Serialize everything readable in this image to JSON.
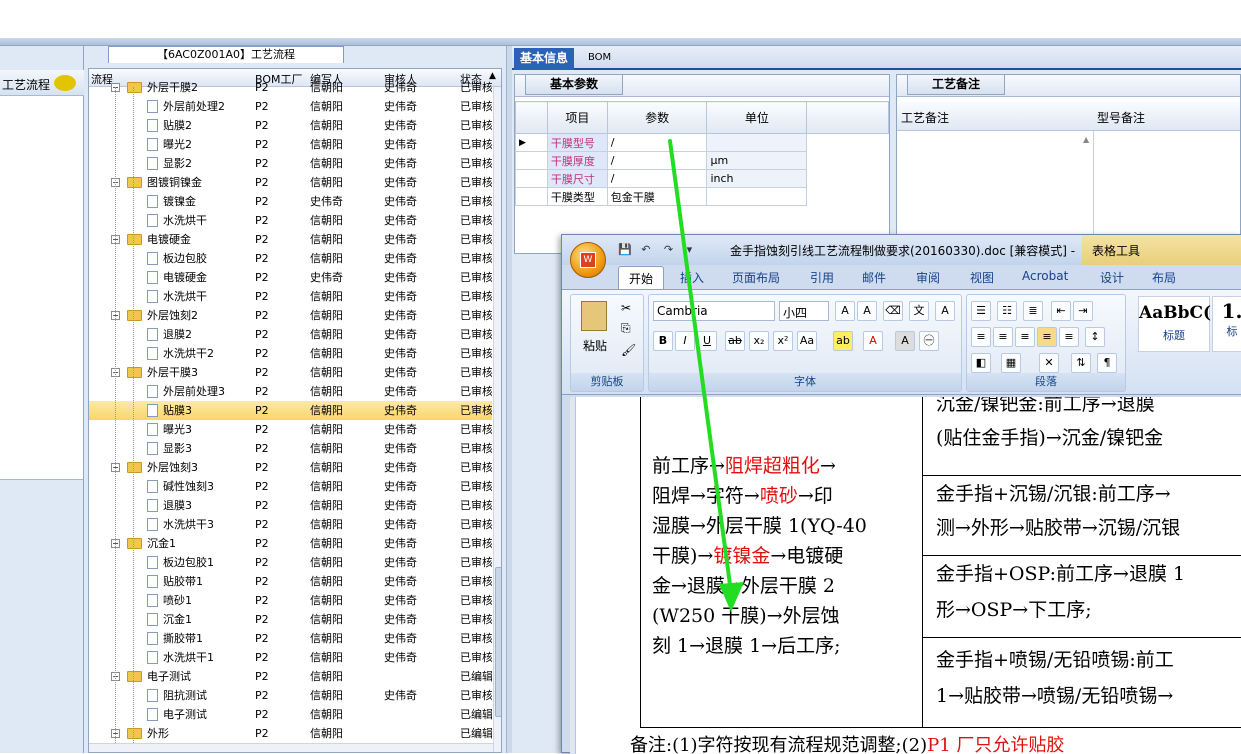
{
  "left_panel": {
    "label": "工艺流程"
  },
  "tree": {
    "title": "【6AC0Z001A0】工艺流程",
    "headers": [
      "流程",
      "BOM工厂",
      "编写人",
      "审核人",
      "状态"
    ],
    "rows": [
      {
        "name": "外层干膜2",
        "level": 1,
        "folder": true,
        "bom": "P2",
        "writer": "信朝阳",
        "reviewer": "史伟奇",
        "status": "已审核"
      },
      {
        "name": "外层前处理2",
        "level": 2,
        "bom": "P2",
        "writer": "信朝阳",
        "reviewer": "史伟奇",
        "status": "已审核"
      },
      {
        "name": "贴膜2",
        "level": 2,
        "bom": "P2",
        "writer": "信朝阳",
        "reviewer": "史伟奇",
        "status": "已审核"
      },
      {
        "name": "曝光2",
        "level": 2,
        "bom": "P2",
        "writer": "信朝阳",
        "reviewer": "史伟奇",
        "status": "已审核"
      },
      {
        "name": "显影2",
        "level": 2,
        "bom": "P2",
        "writer": "信朝阳",
        "reviewer": "史伟奇",
        "status": "已审核"
      },
      {
        "name": "图镀铜镍金",
        "level": 1,
        "folder": true,
        "bom": "P2",
        "writer": "信朝阳",
        "reviewer": "史伟奇",
        "status": "已审核"
      },
      {
        "name": "镀镍金",
        "level": 2,
        "bom": "P2",
        "writer": "史伟奇",
        "reviewer": "史伟奇",
        "status": "已审核"
      },
      {
        "name": "水洗烘干",
        "level": 2,
        "bom": "P2",
        "writer": "信朝阳",
        "reviewer": "史伟奇",
        "status": "已审核"
      },
      {
        "name": "电镀硬金",
        "level": 1,
        "folder": true,
        "bom": "P2",
        "writer": "信朝阳",
        "reviewer": "史伟奇",
        "status": "已审核"
      },
      {
        "name": "板边包胶",
        "level": 2,
        "bom": "P2",
        "writer": "信朝阳",
        "reviewer": "史伟奇",
        "status": "已审核"
      },
      {
        "name": "电镀硬金",
        "level": 2,
        "bom": "P2",
        "writer": "史伟奇",
        "reviewer": "史伟奇",
        "status": "已审核"
      },
      {
        "name": "水洗烘干",
        "level": 2,
        "bom": "P2",
        "writer": "信朝阳",
        "reviewer": "史伟奇",
        "status": "已审核"
      },
      {
        "name": "外层蚀刻2",
        "level": 1,
        "folder": true,
        "bom": "P2",
        "writer": "信朝阳",
        "reviewer": "史伟奇",
        "status": "已审核"
      },
      {
        "name": "退膜2",
        "level": 2,
        "bom": "P2",
        "writer": "信朝阳",
        "reviewer": "史伟奇",
        "status": "已审核"
      },
      {
        "name": "水洗烘干2",
        "level": 2,
        "bom": "P2",
        "writer": "信朝阳",
        "reviewer": "史伟奇",
        "status": "已审核"
      },
      {
        "name": "外层干膜3",
        "level": 1,
        "folder": true,
        "bom": "P2",
        "writer": "信朝阳",
        "reviewer": "史伟奇",
        "status": "已审核"
      },
      {
        "name": "外层前处理3",
        "level": 2,
        "bom": "P2",
        "writer": "信朝阳",
        "reviewer": "史伟奇",
        "status": "已审核"
      },
      {
        "name": "贴膜3",
        "level": 2,
        "bom": "P2",
        "writer": "信朝阳",
        "reviewer": "史伟奇",
        "status": "已审核",
        "selected": true
      },
      {
        "name": "曝光3",
        "level": 2,
        "bom": "P2",
        "writer": "信朝阳",
        "reviewer": "史伟奇",
        "status": "已审核"
      },
      {
        "name": "显影3",
        "level": 2,
        "bom": "P2",
        "writer": "信朝阳",
        "reviewer": "史伟奇",
        "status": "已审核"
      },
      {
        "name": "外层蚀刻3",
        "level": 1,
        "folder": true,
        "bom": "P2",
        "writer": "信朝阳",
        "reviewer": "史伟奇",
        "status": "已审核"
      },
      {
        "name": "碱性蚀刻3",
        "level": 2,
        "bom": "P2",
        "writer": "信朝阳",
        "reviewer": "史伟奇",
        "status": "已审核"
      },
      {
        "name": "退膜3",
        "level": 2,
        "bom": "P2",
        "writer": "信朝阳",
        "reviewer": "史伟奇",
        "status": "已审核"
      },
      {
        "name": "水洗烘干3",
        "level": 2,
        "bom": "P2",
        "writer": "信朝阳",
        "reviewer": "史伟奇",
        "status": "已审核"
      },
      {
        "name": "沉金1",
        "level": 1,
        "folder": true,
        "bom": "P2",
        "writer": "信朝阳",
        "reviewer": "史伟奇",
        "status": "已审核"
      },
      {
        "name": "板边包胶1",
        "level": 2,
        "bom": "P2",
        "writer": "信朝阳",
        "reviewer": "史伟奇",
        "status": "已审核"
      },
      {
        "name": "贴胶带1",
        "level": 2,
        "bom": "P2",
        "writer": "信朝阳",
        "reviewer": "史伟奇",
        "status": "已审核"
      },
      {
        "name": "喷砂1",
        "level": 2,
        "bom": "P2",
        "writer": "信朝阳",
        "reviewer": "史伟奇",
        "status": "已审核"
      },
      {
        "name": "沉金1",
        "level": 2,
        "bom": "P2",
        "writer": "信朝阳",
        "reviewer": "史伟奇",
        "status": "已审核"
      },
      {
        "name": "撕胶带1",
        "level": 2,
        "bom": "P2",
        "writer": "信朝阳",
        "reviewer": "史伟奇",
        "status": "已审核"
      },
      {
        "name": "水洗烘干1",
        "level": 2,
        "bom": "P2",
        "writer": "信朝阳",
        "reviewer": "史伟奇",
        "status": "已审核"
      },
      {
        "name": "电子测试",
        "level": 1,
        "folder": true,
        "bom": "P2",
        "writer": "信朝阳",
        "reviewer": "",
        "status": "已编辑"
      },
      {
        "name": "阻抗测试",
        "level": 2,
        "bom": "P2",
        "writer": "信朝阳",
        "reviewer": "史伟奇",
        "status": "已审核"
      },
      {
        "name": "电子测试",
        "level": 2,
        "bom": "P2",
        "writer": "信朝阳",
        "reviewer": "",
        "status": "已编辑"
      },
      {
        "name": "外形",
        "level": 1,
        "folder": true,
        "bom": "P2",
        "writer": "信朝阳",
        "reviewer": "",
        "status": "已编辑"
      }
    ]
  },
  "tabs": {
    "basic": "基本信息",
    "bom": "BOM"
  },
  "params": {
    "group_title": "基本参数",
    "headers": [
      "项目",
      "参数",
      "单位"
    ],
    "rows": [
      {
        "item": "干膜型号",
        "value": "/",
        "unit": ""
      },
      {
        "item": "干膜厚度",
        "value": "/",
        "unit": "μm"
      },
      {
        "item": "干膜尺寸",
        "value": "/",
        "unit": "inch"
      },
      {
        "item": "干膜类型",
        "value": "包金干膜",
        "unit": ""
      }
    ]
  },
  "remarks": {
    "group_title": "工艺备注",
    "col1": "工艺备注",
    "col2": "型号备注"
  },
  "word": {
    "title": "金手指蚀刻引线工艺流程制做要求(20160330).doc [兼容模式] -",
    "context_tab": "表格工具",
    "tabs": [
      "开始",
      "插入",
      "页面布局",
      "引用",
      "邮件",
      "审阅",
      "视图",
      "Acrobat",
      "设计",
      "布局"
    ],
    "font_name": "Cambria",
    "font_size": "小四",
    "groups": {
      "clipboard": "剪贴板",
      "font": "字体",
      "paragraph": "段落"
    },
    "paste": "粘贴",
    "styles": [
      {
        "preview": "AaBbC(",
        "label": "标题"
      },
      {
        "preview": "1.",
        "label": "标"
      }
    ],
    "doc": {
      "l1a": "前工序→",
      "l1b": "阻焊超粗化",
      "l1c": "→",
      "l2a": "阻焊→字符→",
      "l2b": "喷砂",
      "l2c": "→印",
      "l3": "湿膜→外层干膜 1(YQ-40",
      "l4a": "干膜)→",
      "l4b": "镀镍金",
      "l4c": "→电镀硬",
      "l5": "金→退膜→外层干膜 2",
      "l6": "(W250 干膜)→外层蚀",
      "l7": "刻 1→退膜 1→后工序;",
      "r1": "沉金/镍钯金:前工序→退膜",
      "r2": "(贴住金手指)→沉金/镍钯金",
      "r3": "金手指+沉锡/沉银:前工序→",
      "r4": "测→外形→贴胶带→沉锡/沉银",
      "r5": "金手指+OSP:前工序→退膜 1",
      "r6": "形→OSP→下工序;",
      "r7": "金手指+喷锡/无铅喷锡:前工",
      "r8": "1→贴胶带→喷锡/无铅喷锡→",
      "note_a": "备注:(1)字符按现有流程规范调整;(2)",
      "note_b": "P1 厂只允许贴胶"
    }
  },
  "colors": {
    "accent": "#2b62b5",
    "selected_row": "#f9d66a",
    "arrow": "#22dd22",
    "red_text": "#e01010"
  }
}
